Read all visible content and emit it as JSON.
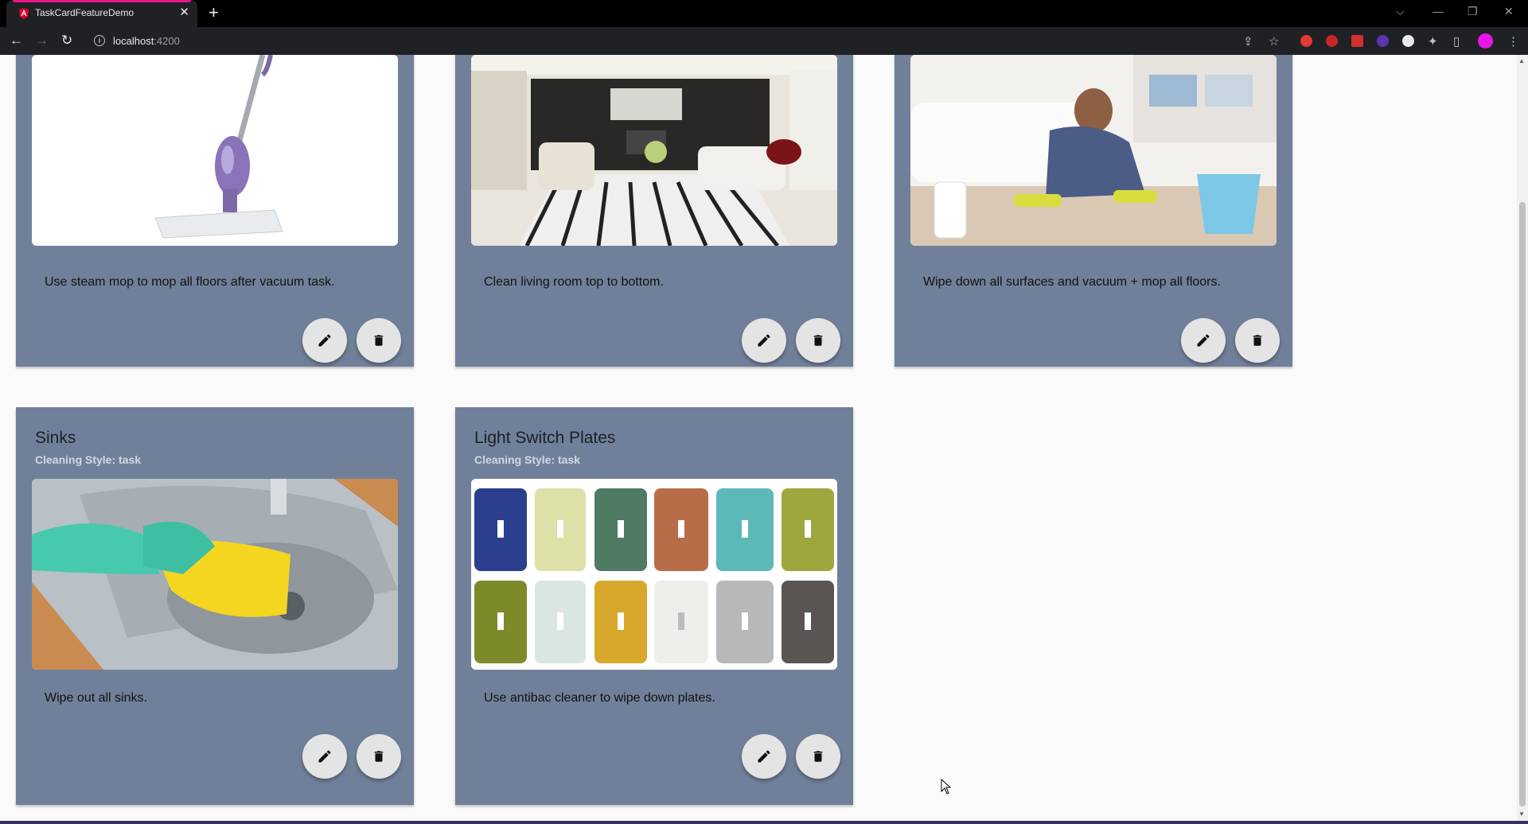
{
  "browser": {
    "tab_title": "TaskCardFeatureDemo",
    "tab_close": "✕",
    "new_tab": "+",
    "url_host": "localhost",
    "url_port": ":4200",
    "accent_color": "#e8168a"
  },
  "cards": [
    {
      "title": "",
      "subtitle": "",
      "description": "Use steam mop to mop all floors after vacuum task.",
      "image": "steam mop"
    },
    {
      "title": "",
      "subtitle": "",
      "description": "Clean living room top to bottom.",
      "image": "living room"
    },
    {
      "title": "",
      "subtitle": "",
      "description": "Wipe down all surfaces and vacuum + mop all floors.",
      "image": "man mopping floor"
    },
    {
      "title": "Sinks",
      "subtitle": "Cleaning Style: task",
      "description": "Wipe out all sinks.",
      "image": "gloved hand wiping sink"
    },
    {
      "title": "Light Switch Plates",
      "subtitle": "Cleaning Style: task",
      "description": "Use antibac cleaner to wipe down plates.",
      "image": "decorative light switch plates"
    }
  ],
  "colors": {
    "card_background": "#71809a",
    "page_background": "#fafafa",
    "fab_background": "#e4e4e4"
  }
}
